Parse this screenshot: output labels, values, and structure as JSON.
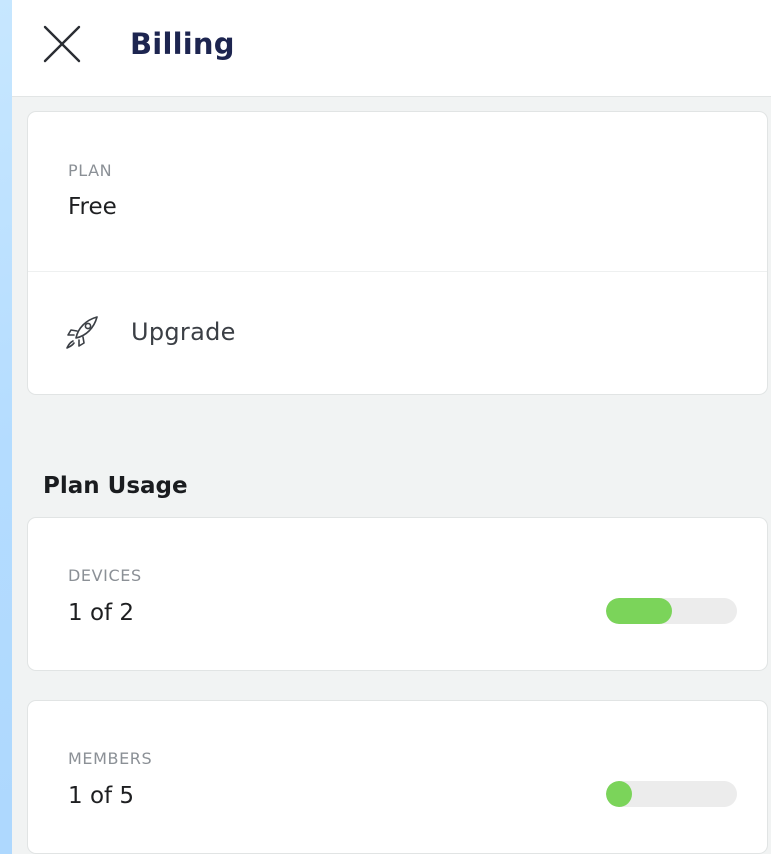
{
  "header": {
    "title": "Billing"
  },
  "plan": {
    "label": "PLAN",
    "value": "Free",
    "upgrade_label": "Upgrade"
  },
  "usage": {
    "section_title": "Plan Usage",
    "devices": {
      "label": "DEVICES",
      "value": "1 of 2",
      "used": 1,
      "limit": 2
    },
    "members": {
      "label": "MEMBERS",
      "value": "1 of 5",
      "used": 1,
      "limit": 5
    }
  },
  "colors": {
    "title": "#1d2550",
    "progress_fill": "#7bd45a",
    "progress_track": "#ececec",
    "background": "#f1f3f3"
  },
  "icons": {
    "close": "close-icon",
    "upgrade": "rocket-icon"
  }
}
